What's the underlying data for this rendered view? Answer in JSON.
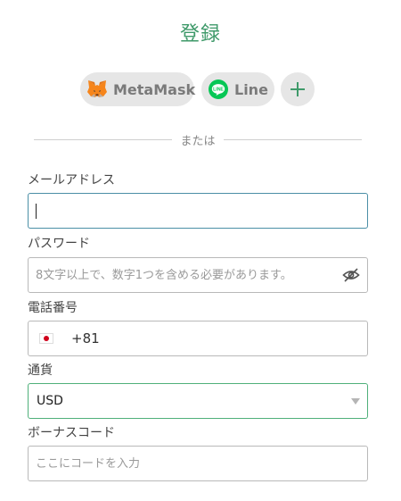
{
  "title": "登録",
  "social": {
    "metamask_label": "MetaMask",
    "line_label": "Line",
    "line_icon_text": "LINE",
    "more_label": "+"
  },
  "divider_text": "または",
  "form": {
    "email": {
      "label": "メールアドレス",
      "value": ""
    },
    "password": {
      "label": "パスワード",
      "placeholder": "8文字以上で、数字1つを含める必要があります。"
    },
    "phone": {
      "label": "電話番号",
      "code": "+81"
    },
    "currency": {
      "label": "通貨",
      "selected": "USD"
    },
    "bonus": {
      "label": "ボーナスコード",
      "placeholder": "ここにコードを入力"
    }
  },
  "colors": {
    "title": "#3f9a6a",
    "line_brand": "#06c755",
    "metamask": "#e2761b",
    "email_focus": "#4b8fa6",
    "currency_border": "#4fb07a"
  },
  "icons": {
    "metamask": "metamask-fox-icon",
    "line": "line-logo-icon",
    "plus": "plus-icon",
    "eye": "eye-hidden-icon",
    "flag": "japan-flag-icon",
    "dropdown": "chevron-down-icon"
  }
}
